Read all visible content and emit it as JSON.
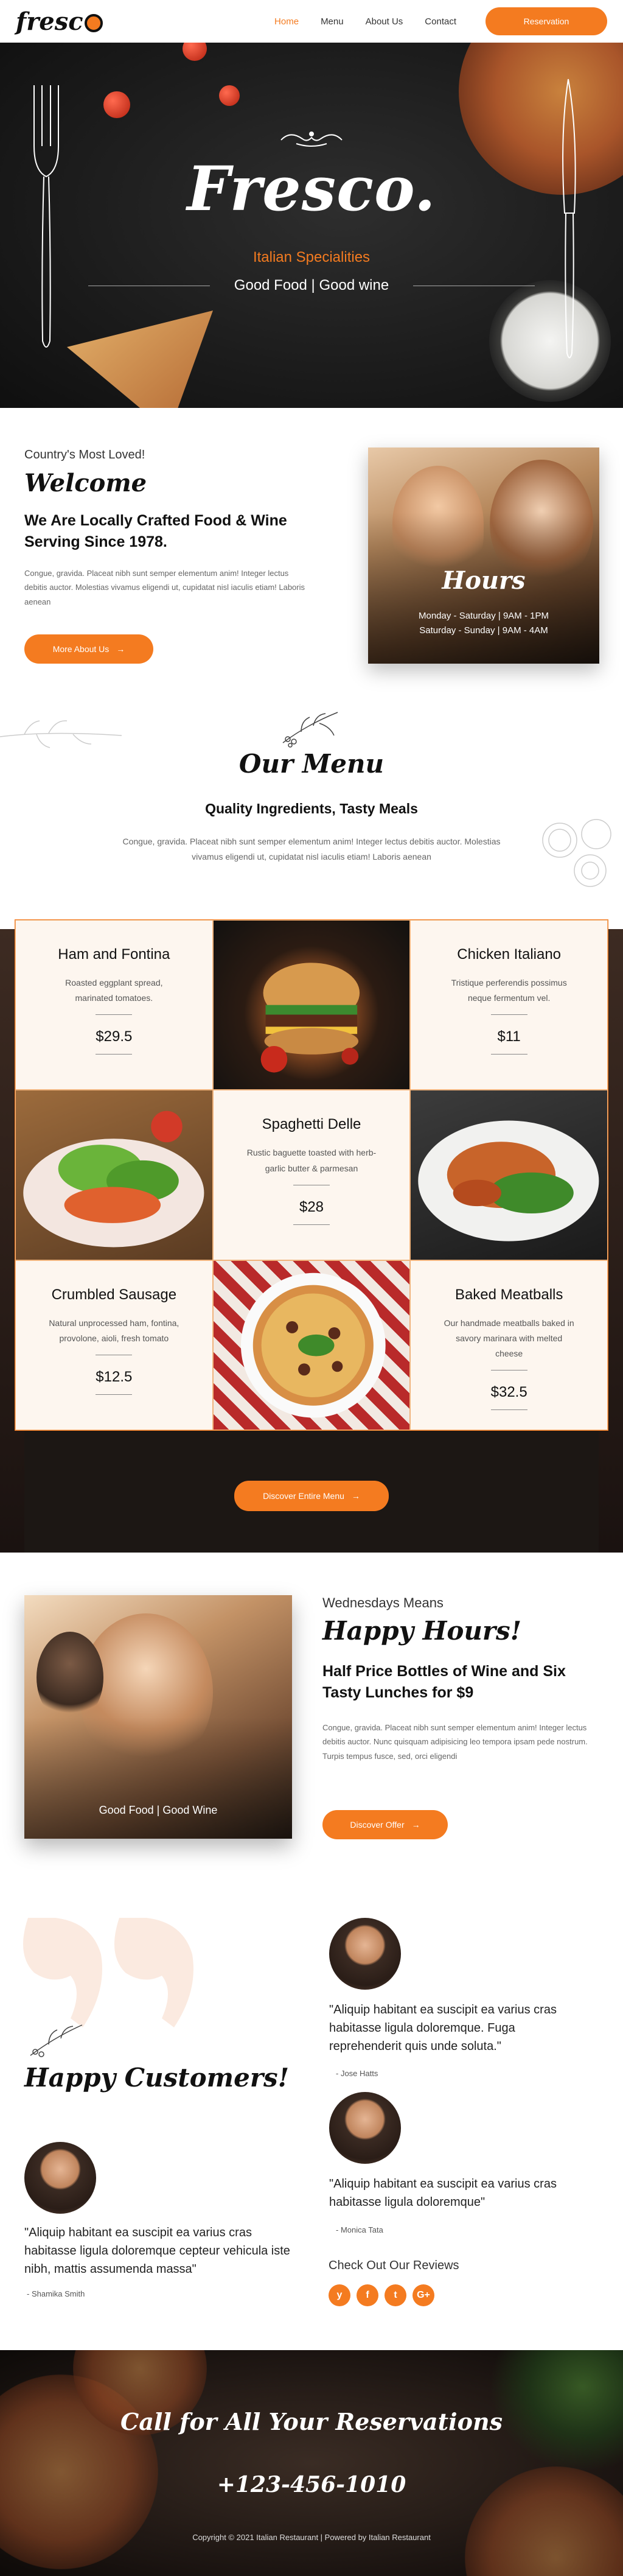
{
  "nav": {
    "logo": "fresc",
    "links": [
      "Home",
      "Menu",
      "About Us",
      "Contact"
    ],
    "reservation": "Reservation"
  },
  "hero": {
    "title": "Fresco.",
    "subtitle": "Italian Specialities",
    "tagline": "Good Food | Good wine"
  },
  "welcome": {
    "eyebrow": "Country's Most Loved!",
    "title": "Welcome",
    "headline": "We Are Locally Crafted Food & Wine Serving Since 1978.",
    "body": "Congue, gravida. Placeat nibh sunt semper elementum anim! Integer lectus debitis auctor. Molestias vivamus eligendi ut, cupidatat nisl iaculis etiam! Laboris aenean",
    "button": "More About Us",
    "hours_title": "Hours",
    "hours_lines": [
      "Monday - Saturday | 9AM - 1PM",
      "Saturday - Sunday | 9AM - 4AM"
    ]
  },
  "menu_intro": {
    "title": "Our Menu",
    "headline": "Quality Ingredients, Tasty Meals",
    "body": "Congue, gravida. Placeat nibh sunt semper elementum anim! Integer lectus debitis auctor. Molestias vivamus eligendi ut, cupidatat nisl iaculis etiam! Laboris aenean"
  },
  "menu_items": [
    {
      "name": "Ham and Fontina",
      "desc": "Roasted eggplant spread, marinated tomatoes.",
      "price": "$29.5"
    },
    {
      "name": "Chicken Italiano",
      "desc": "Tristique perferendis possimus neque fermentum vel.",
      "price": "$11"
    },
    {
      "name": "Spaghetti Delle",
      "desc": "Rustic baguette toasted with herb-garlic butter & parmesan",
      "price": "$28"
    },
    {
      "name": "Crumbled Sausage",
      "desc": "Natural unprocessed ham, fontina, provolone, aioli, fresh tomato",
      "price": "$12.5"
    },
    {
      "name": "Baked Meatballs",
      "desc": "Our handmade meatballs baked in savory marinara with melted cheese",
      "price": "$32.5"
    }
  ],
  "menu_button": "Discover Entire Menu",
  "happy": {
    "eyebrow": "Wednesdays Means",
    "title": "Happy Hours!",
    "headline": "Half Price Bottles of Wine and Six Tasty Lunches for $9",
    "body": "Congue, gravida. Placeat nibh sunt semper elementum anim! Integer lectus debitis auctor. Nunc quisquam adipisicing leo tempora ipsam pede nostrum. Turpis tempus fusce, sed, orci eligendi",
    "image_caption": "Good Food | Good Wine",
    "button": "Discover Offer"
  },
  "testimonials": {
    "title": "Happy Customers!",
    "items": [
      {
        "quote": "\"Aliquip habitant ea suscipit ea varius cras habitasse ligula doloremque. Fuga reprehenderit quis unde soluta.\"",
        "name": "- Jose Hatts"
      },
      {
        "quote": "\"Aliquip habitant ea suscipit ea varius cras habitasse ligula doloremque\"",
        "name": "- Monica Tata"
      },
      {
        "quote": "\"Aliquip habitant ea suscipit ea varius cras habitasse ligula doloremque cepteur vehicula iste nibh, mattis assumenda massa\"",
        "name": "- Shamika Smith"
      }
    ],
    "check_out": "Check Out Our Reviews",
    "social_icons": [
      "yelp-icon",
      "facebook-icon",
      "twitter-icon",
      "google-plus-icon"
    ]
  },
  "footer": {
    "title": "Call for All Your Reservations",
    "phone": "+123-456-1010",
    "copyright": "Copyright © 2021 Italian Restaurant | Powered by Italian Restaurant"
  },
  "colors": {
    "accent": "#f47b20",
    "dark": "#111111"
  }
}
